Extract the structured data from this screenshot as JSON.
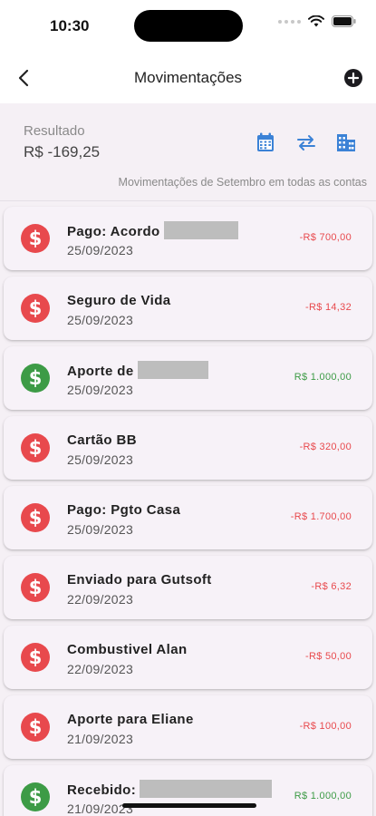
{
  "status_bar": {
    "time": "10:30"
  },
  "header": {
    "title": "Movimentações",
    "back_icon": "chevron-left-icon",
    "add_icon": "plus-circle-icon"
  },
  "summary": {
    "label": "Resultado",
    "value": "R$ -169,25",
    "caption": "Movimentações de Setembro em todas as contas",
    "actions": [
      "calendar-icon",
      "swap-icon",
      "building-icon"
    ],
    "accent_color": "#3b82d6"
  },
  "colors": {
    "expense": "#e8494d",
    "income": "#3d9b46"
  },
  "transactions": [
    {
      "title": "Pago: Acordo",
      "date": "25/09/2023",
      "amount": "-R$ 700,00",
      "type": "out"
    },
    {
      "title": "Seguro de Vida",
      "date": "25/09/2023",
      "amount": "-R$ 14,32",
      "type": "out"
    },
    {
      "title": "Aporte de",
      "date": "25/09/2023",
      "amount": "R$ 1.000,00",
      "type": "in"
    },
    {
      "title": "Cartão BB",
      "date": "25/09/2023",
      "amount": "-R$ 320,00",
      "type": "out"
    },
    {
      "title": "Pago: Pgto Casa",
      "date": "25/09/2023",
      "amount": "-R$ 1.700,00",
      "type": "out"
    },
    {
      "title": "Enviado para Gutsoft",
      "date": "22/09/2023",
      "amount": "-R$ 6,32",
      "type": "out"
    },
    {
      "title": "Combustivel Alan",
      "date": "22/09/2023",
      "amount": "-R$ 50,00",
      "type": "out"
    },
    {
      "title": "Aporte para Eliane",
      "date": "21/09/2023",
      "amount": "-R$ 100,00",
      "type": "out"
    },
    {
      "title": "Recebido:",
      "date": "21/09/2023",
      "amount": "R$ 1.000,00",
      "type": "in"
    }
  ]
}
